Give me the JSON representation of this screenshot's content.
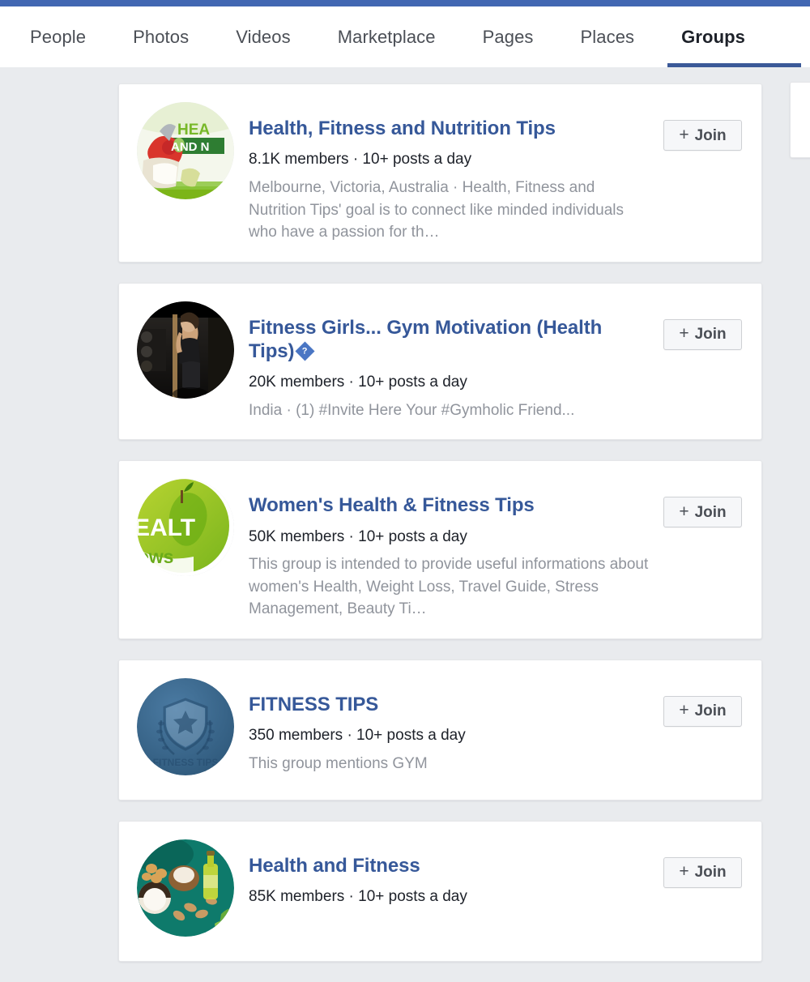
{
  "theme": {
    "chrome_blue": "#4267b2",
    "link_blue": "#365899",
    "page_background": "#e9ebee",
    "card_background": "#ffffff",
    "meta_text": "#1d2129",
    "desc_text": "#90949c"
  },
  "nav": {
    "tabs": [
      {
        "label": "People",
        "active": false
      },
      {
        "label": "Photos",
        "active": false
      },
      {
        "label": "Videos",
        "active": false
      },
      {
        "label": "Marketplace",
        "active": false
      },
      {
        "label": "Pages",
        "active": false
      },
      {
        "label": "Places",
        "active": false
      },
      {
        "label": "Groups",
        "active": true
      }
    ]
  },
  "join_button": {
    "plus_icon": "+",
    "label": "Join"
  },
  "results": [
    {
      "title": "Health, Fitness and Nutrition Tips",
      "title_suffix": "",
      "has_missing_glyph": false,
      "meta": "8.1K members · 10+ posts a day",
      "description": "Melbourne, Victoria, Australia · Health, Fitness and Nutrition Tips' goal is to connect like minded individuals who have a passion for th…",
      "avatar": {
        "name": "health-nutrition-avatar",
        "text_top": "HEA",
        "text_badge": "AND N"
      }
    },
    {
      "title": "Fitness Girls... Gym Motivation (Health Tips)",
      "title_suffix": "",
      "has_missing_glyph": true,
      "missing_glyph_char": "?",
      "meta": "20K members · 10+ posts a day",
      "description": "India · (1) #Invite Here Your #Gymholic Friend...",
      "avatar": {
        "name": "gym-motivation-avatar",
        "text_top": "",
        "text_badge": ""
      }
    },
    {
      "title": "Women's Health & Fitness Tips",
      "title_suffix": "",
      "has_missing_glyph": false,
      "meta": "50K members · 10+ posts a day",
      "description": "This group is intended to provide useful informations about women's Health, Weight Loss, Travel Guide, Stress Management, Beauty Ti…",
      "avatar": {
        "name": "womens-health-avatar",
        "text_top": "EALT",
        "text_badge": "ews"
      }
    },
    {
      "title": "FITNESS TIPS",
      "title_suffix": "",
      "has_missing_glyph": false,
      "meta": "350 members · 10+ posts a day",
      "description": "This group mentions GYM",
      "avatar": {
        "name": "fitness-tips-crest-avatar",
        "text_top": "",
        "text_badge": ""
      }
    },
    {
      "title": "Health and Fitness",
      "title_suffix": "",
      "has_missing_glyph": false,
      "meta": "85K members · 10+ posts a day",
      "description": "",
      "avatar": {
        "name": "health-and-fitness-avatar",
        "text_top": "",
        "text_badge": ""
      }
    }
  ]
}
